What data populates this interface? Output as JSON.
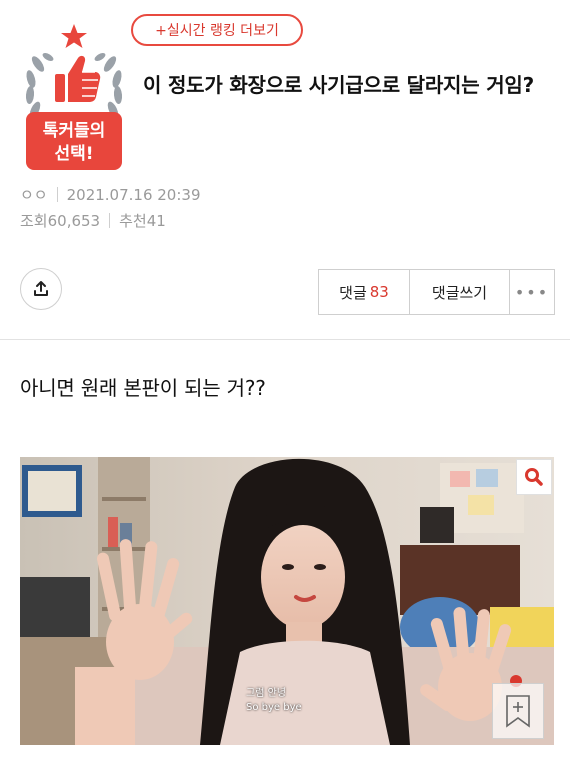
{
  "ranking_button": "+실시간 랭킹 더보기",
  "badge": {
    "line1": "톡커들의",
    "line2": "선택!",
    "color": "#e8463c"
  },
  "post": {
    "title": "이 정도가 화장으로 사기급으로 달라지는 거임?",
    "author": "ㅇㅇ",
    "datetime": "2021.07.16 20:39",
    "views_label": "조회",
    "views": "60,653",
    "recommend_label": "추천",
    "recommend": "41",
    "body": "아니면 원래 본판이 되는 거??"
  },
  "actions": {
    "comment_label": "댓글",
    "comment_count": "83",
    "write_comment": "댓글쓰기",
    "more": "•••"
  },
  "image": {
    "caption_line1": "그럼 안녕",
    "caption_line2": "So bye bye"
  },
  "icons": {
    "share": "share-icon",
    "search": "search-icon",
    "bookmark": "bookmark-add-icon",
    "star": "star-icon",
    "thumbs": "thumbs-up-icon"
  },
  "colors": {
    "accent": "#d9382e",
    "muted": "#9a9a9a"
  }
}
